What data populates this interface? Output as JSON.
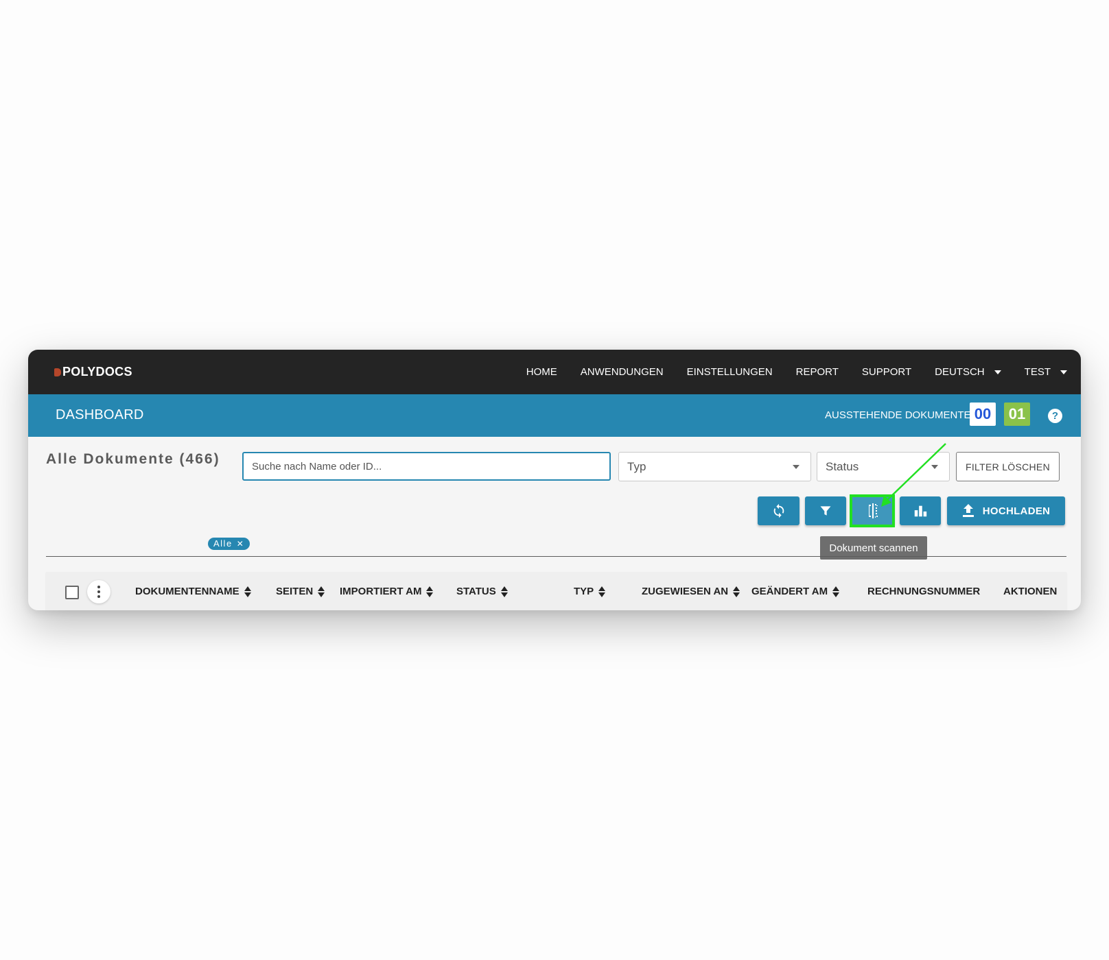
{
  "nav": {
    "logo": "POLYDOCS",
    "items": [
      "HOME",
      "ANWENDUNGEN",
      "EINSTELLUNGEN",
      "REPORT",
      "SUPPORT"
    ],
    "language": "DEUTSCH",
    "user": "TEST"
  },
  "dashboard": {
    "title": "DASHBOARD",
    "pending_label": "AUSSTEHENDE DOKUMENTE:",
    "pending_blue": "00",
    "pending_green": "01",
    "help": "?",
    "colors": {
      "primary": "#2687b1",
      "nav_bg": "#242424",
      "green_badge": "#8bc24a",
      "highlight": "#22e022"
    }
  },
  "content": {
    "heading": "Alle Dokumente (466)",
    "search_placeholder": "Suche nach Name oder ID...",
    "type_select": "Typ",
    "status_select": "Status",
    "filter_clear": "FILTER LÖSCHEN",
    "upload": "HOCHLADEN",
    "tooltip": "Dokument scannen",
    "chip": "Alle",
    "chip_close": "✕"
  },
  "table": {
    "columns": [
      "DOKUMENTENNAME",
      "SEITEN",
      "IMPORTIERT AM",
      "STATUS",
      "TYP",
      "ZUGEWIESEN AN",
      "GEÄNDERT AM",
      "RECHNUNGSNUMMER",
      "AKTIONEN"
    ]
  }
}
